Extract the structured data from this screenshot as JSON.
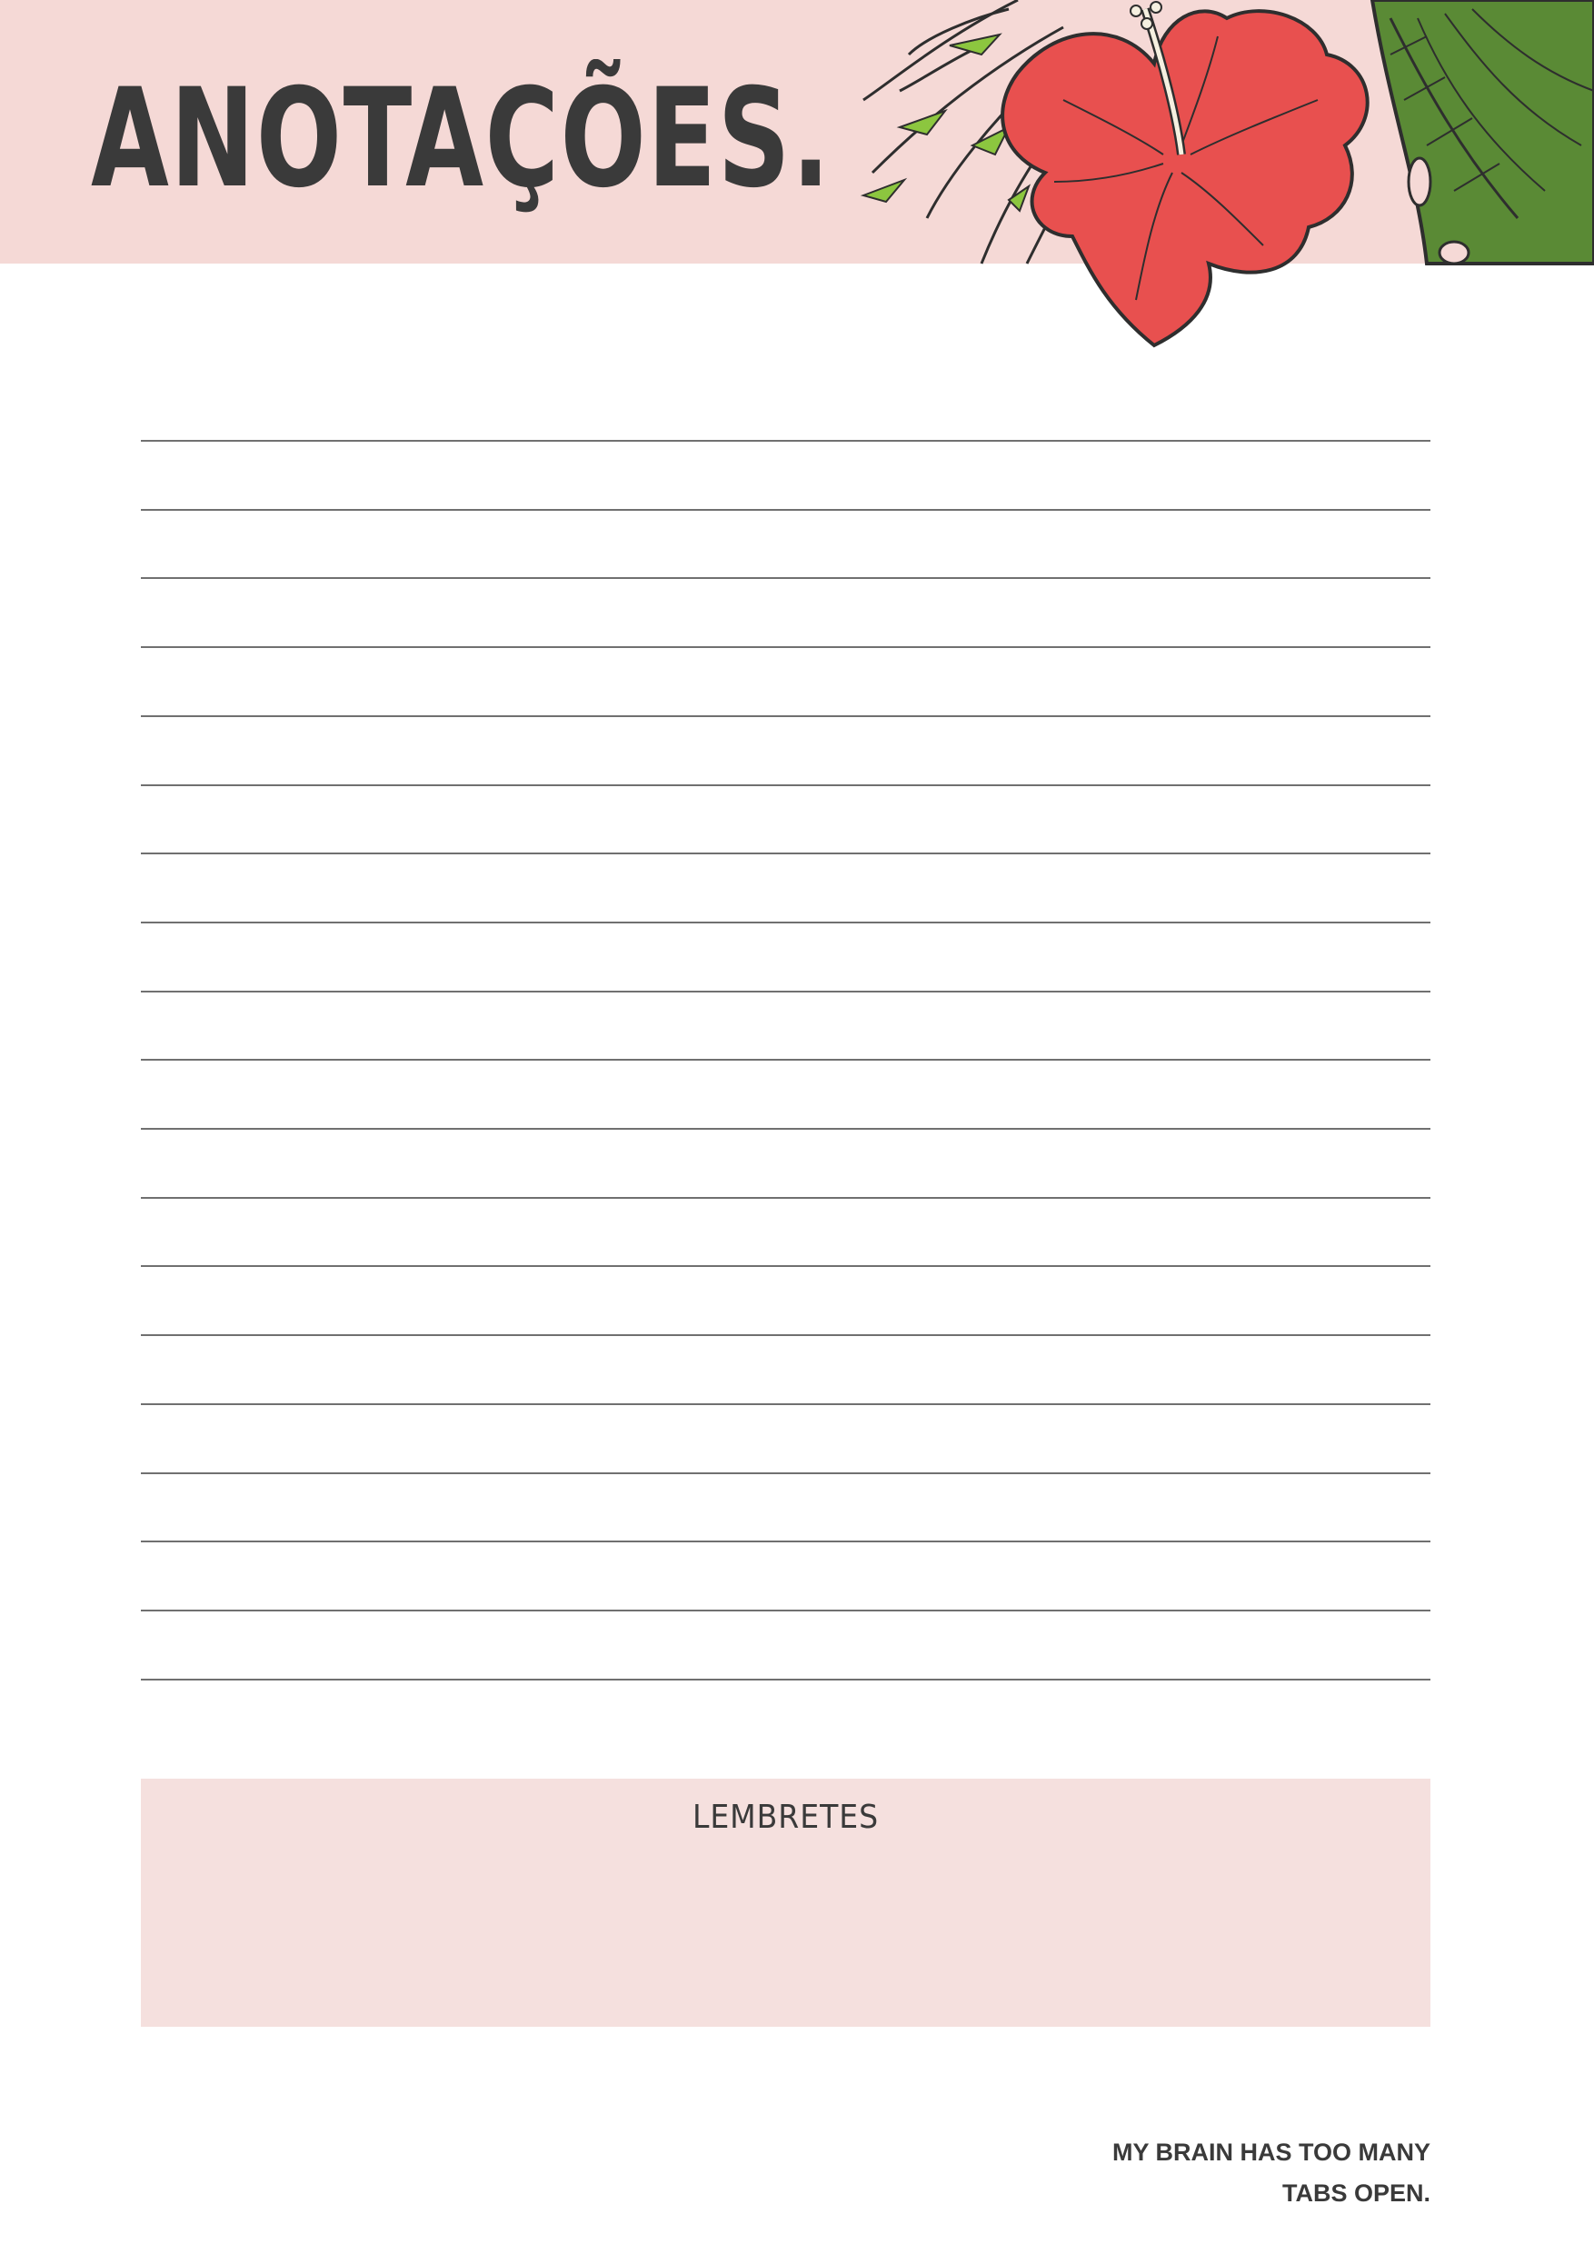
{
  "header": {
    "title": "ANOTAÇÕES."
  },
  "illustration": {
    "name": "tropical-hibiscus-and-palm-leaves"
  },
  "notes": {
    "line_count": 19
  },
  "reminders": {
    "label": "LEMBRETES"
  },
  "footer": {
    "quote_line_1": "MY BRAIN HAS TOO MANY",
    "quote_line_2": "TABS OPEN."
  },
  "colors": {
    "header_pink": "#f5d9d6",
    "reminders_pink": "#f5e0de",
    "text_dark": "#3a3a3a",
    "rule_gray": "#707070",
    "hibiscus_red": "#e8504f",
    "leaf_green": "#5a8a35",
    "leaf_light_green": "#8cc63f"
  }
}
